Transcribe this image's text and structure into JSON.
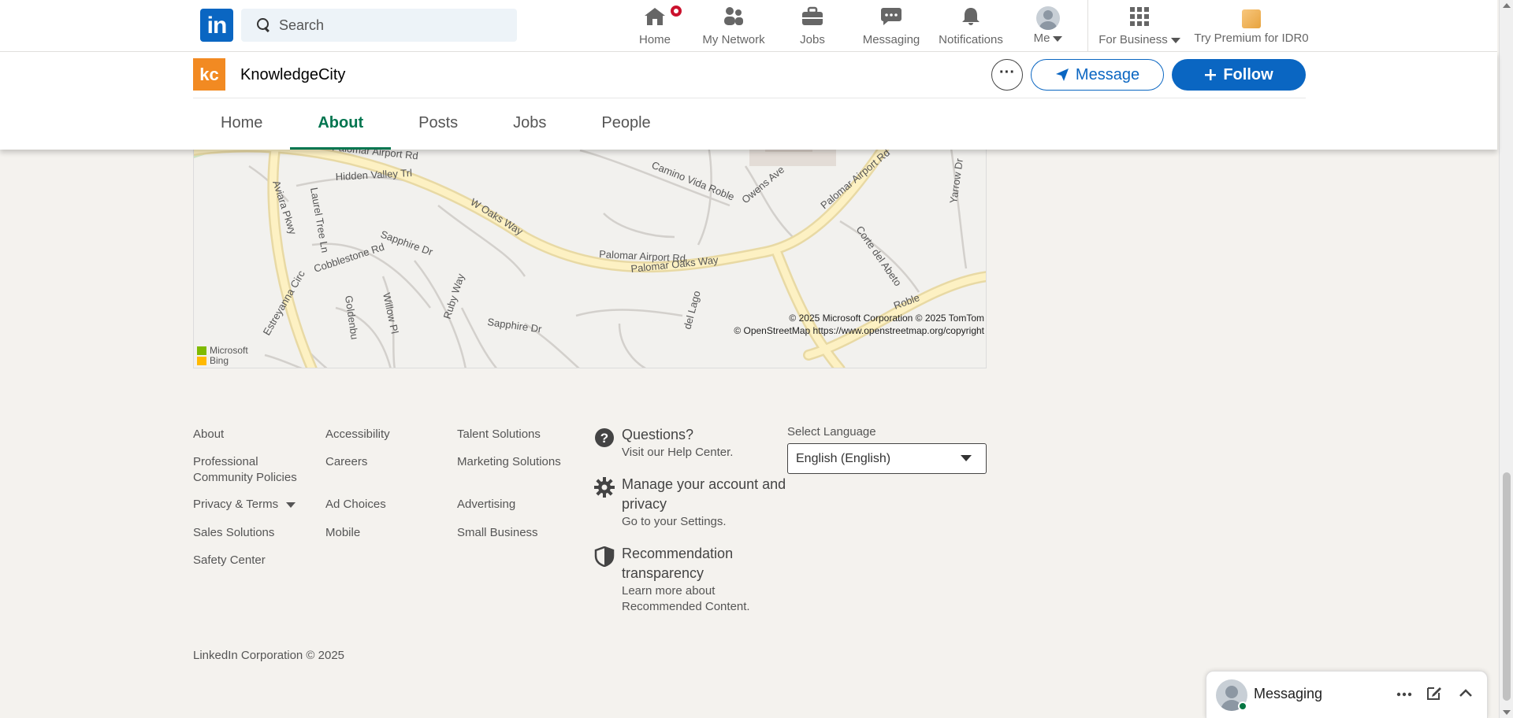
{
  "nav": {
    "search_placeholder": "Search",
    "items": [
      {
        "label": "Home",
        "icon": "home-icon"
      },
      {
        "label": "My Network",
        "icon": "network-icon"
      },
      {
        "label": "Jobs",
        "icon": "briefcase-icon"
      },
      {
        "label": "Messaging",
        "icon": "messaging-icon"
      },
      {
        "label": "Notifications",
        "icon": "bell-icon"
      },
      {
        "label": "Me",
        "icon": "avatar"
      }
    ],
    "for_business": "For Business",
    "premium": "Try Premium for IDR0",
    "logo_text": "in"
  },
  "company": {
    "logo_text": "kc",
    "name": "KnowledgeCity",
    "more": "···",
    "message_label": "Message",
    "follow_label": "Follow",
    "tabs": [
      {
        "label": "Home",
        "active": false
      },
      {
        "label": "About",
        "active": true
      },
      {
        "label": "Posts",
        "active": false
      },
      {
        "label": "Jobs",
        "active": false
      },
      {
        "label": "People",
        "active": false
      }
    ]
  },
  "map": {
    "roads": {
      "palomar1": "Palomar Airport Rd",
      "palomar2": "Palomar Airport Rd",
      "palomar3": "Palomar Airport Rd",
      "hidden_valley": "Hidden Valley Trl",
      "aviara": "Aviara Pkwy",
      "laurel": "Laurel Tree Ln",
      "woaks": "W Oaks Way",
      "sapphire1": "Sapphire Dr",
      "sapphire2": "Sapphire Dr",
      "cobblestone": "Cobblestone Rd",
      "camino": "Camino Vida Roble",
      "camino2": "Roble",
      "owens": "Owens Ave",
      "yarrow": "Yarrow Dr",
      "corte": "Corte del Abeto",
      "palomar_oaks": "Palomar Oaks Way",
      "del_lago": "del Lago",
      "ruby": "Ruby Way",
      "willow": "Willow Pl",
      "golden": "Goldenbu",
      "estrella": "Estreyanna Circ"
    },
    "copyright1": "© 2025 Microsoft Corporation © 2025 TomTom",
    "copyright2": "© OpenStreetMap https://www.openstreetmap.org/copyright",
    "bing_line1": "Microsoft",
    "bing_line2": "Bing"
  },
  "footer": {
    "col1": [
      "About",
      "Professional Community Policies",
      "Privacy & Terms",
      "Sales Solutions",
      "Safety Center"
    ],
    "col2": [
      "Accessibility",
      "Careers",
      "Ad Choices",
      "Mobile"
    ],
    "col3": [
      "Talent Solutions",
      "Marketing Solutions",
      "Advertising",
      "Small Business"
    ],
    "help": [
      {
        "title": "Questions?",
        "sub": "Visit our Help Center.",
        "icon": "question-icon"
      },
      {
        "title": "Manage your account and privacy",
        "sub": "Go to your Settings.",
        "icon": "gear-icon"
      },
      {
        "title": "Recommendation transparency",
        "sub": "Learn more about Recommended Content.",
        "icon": "shield-icon"
      }
    ],
    "language_label": "Select Language",
    "language_value": "English (English)",
    "copyright": "LinkedIn Corporation © 2025"
  },
  "messaging_dock": {
    "title": "Messaging"
  },
  "colors": {
    "brand": "#0a66c2",
    "active_tab": "#01754f",
    "company_logo": "#f28a22",
    "page_bg": "#f4f2ee"
  }
}
